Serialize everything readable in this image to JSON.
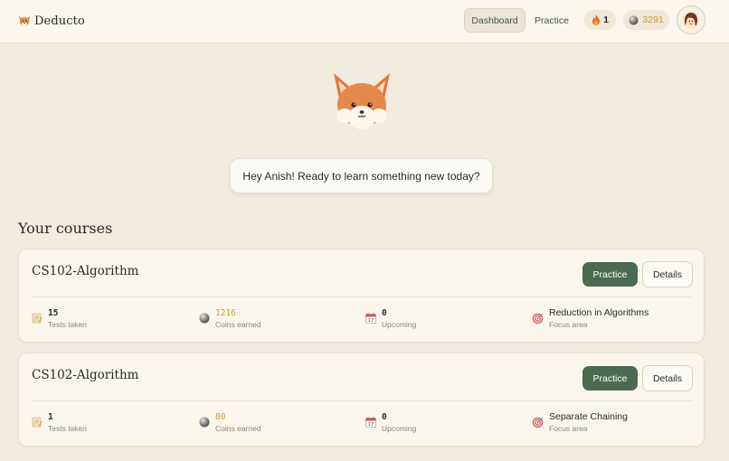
{
  "brand": {
    "name": "Deducto",
    "logo_icon": "fox-icon"
  },
  "nav": {
    "dashboard_label": "Dashboard",
    "practice_label": "Practice",
    "active": "Dashboard"
  },
  "header": {
    "streak_value": "1",
    "streak_icon": "fire-icon",
    "coins_value": "3291",
    "coins_icon": "coin-icon",
    "coins_color": "#c99a3a"
  },
  "greeting": "Hey Anish! Ready to learn something new today?",
  "section_title": "Your courses",
  "colors": {
    "primary_green": "#4a6b50",
    "background": "#f2ebdf",
    "card": "#faf6ee"
  },
  "courses": [
    {
      "title": "CS102-Algorithm",
      "practice_label": "Practice",
      "details_label": "Details",
      "stats": {
        "tests": {
          "value": "15",
          "label": "Tests taken",
          "icon": "notepad-icon"
        },
        "coins": {
          "value": "1216",
          "label": "Coins earned",
          "icon": "coin-icon"
        },
        "upcoming": {
          "value": "0",
          "label": "Upcoming",
          "icon": "calendar-icon"
        },
        "focus": {
          "value": "Reduction in Algorithms",
          "label": "Focus area",
          "icon": "target-icon"
        }
      }
    },
    {
      "title": "CS102-Algorithm",
      "practice_label": "Practice",
      "details_label": "Details",
      "stats": {
        "tests": {
          "value": "1",
          "label": "Tests taken",
          "icon": "notepad-icon"
        },
        "coins": {
          "value": "80",
          "label": "Coins earned",
          "icon": "coin-icon"
        },
        "upcoming": {
          "value": "0",
          "label": "Upcoming",
          "icon": "calendar-icon"
        },
        "focus": {
          "value": "Separate Chaining",
          "label": "Focus area",
          "icon": "target-icon"
        }
      }
    }
  ]
}
